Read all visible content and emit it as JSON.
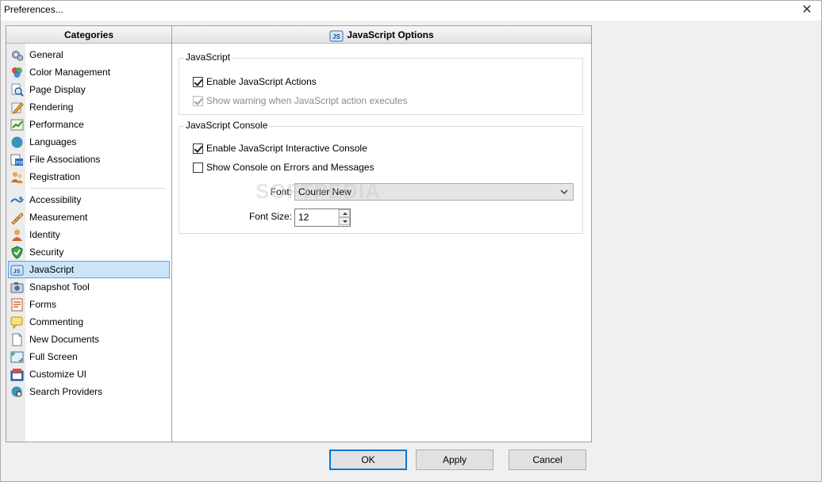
{
  "window": {
    "title": "Preferences..."
  },
  "categories": {
    "header": "Categories",
    "group1": [
      {
        "label": "General",
        "icon": "gears-icon"
      },
      {
        "label": "Color Management",
        "icon": "color-circles-icon"
      },
      {
        "label": "Page Display",
        "icon": "magnifier-page-icon"
      },
      {
        "label": "Rendering",
        "icon": "pencil-render-icon"
      },
      {
        "label": "Performance",
        "icon": "chart-icon"
      },
      {
        "label": "Languages",
        "icon": "globe-icon"
      },
      {
        "label": "File Associations",
        "icon": "file-assoc-icon"
      },
      {
        "label": "Registration",
        "icon": "users-icon"
      }
    ],
    "group2": [
      {
        "label": "Accessibility",
        "icon": "accessibility-icon"
      },
      {
        "label": "Measurement",
        "icon": "ruler-icon"
      },
      {
        "label": "Identity",
        "icon": "person-icon"
      },
      {
        "label": "Security",
        "icon": "shield-icon"
      },
      {
        "label": "JavaScript",
        "icon": "javascript-icon",
        "selected": true
      },
      {
        "label": "Snapshot Tool",
        "icon": "camera-icon"
      },
      {
        "label": "Forms",
        "icon": "form-icon"
      },
      {
        "label": "Commenting",
        "icon": "comment-icon"
      },
      {
        "label": "New Documents",
        "icon": "new-document-icon"
      },
      {
        "label": "Full Screen",
        "icon": "full-screen-icon"
      },
      {
        "label": "Customize UI",
        "icon": "customize-icon"
      },
      {
        "label": "Search Providers",
        "icon": "search-globe-icon"
      }
    ]
  },
  "options": {
    "header": "JavaScript Options",
    "javascript_group": {
      "legend": "JavaScript",
      "enable_actions": {
        "label": "Enable JavaScript Actions",
        "checked": true
      },
      "show_warning": {
        "label": "Show warning when JavaScript action executes",
        "checked": true,
        "disabled": true
      }
    },
    "console_group": {
      "legend": "JavaScript Console",
      "enable_console": {
        "label": "Enable JavaScript Interactive Console",
        "checked": true
      },
      "show_console_errors": {
        "label": "Show Console on Errors and Messages",
        "checked": false
      },
      "font_label": "Font:",
      "font_value": "Courier New",
      "font_size_label": "Font Size:",
      "font_size_value": "12"
    }
  },
  "watermark": "SOFTPEDIA",
  "buttons": {
    "ok": "OK",
    "apply": "Apply",
    "cancel": "Cancel"
  }
}
